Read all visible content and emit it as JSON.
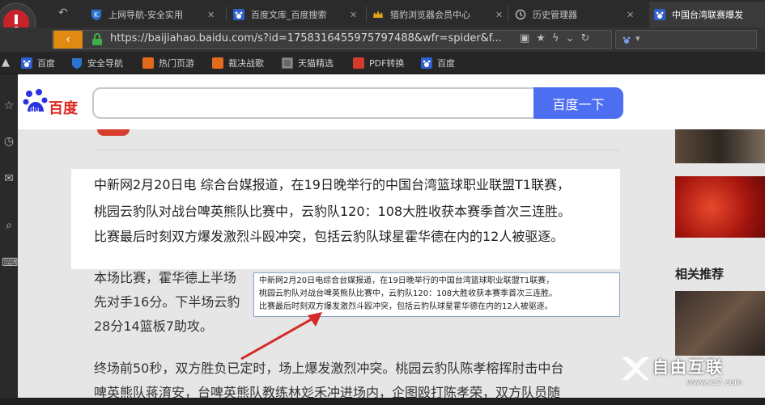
{
  "tabs": [
    {
      "label": "上网导航-安全实用",
      "icon": "shield-k-icon",
      "active": false
    },
    {
      "label": "百度文库_百度搜索",
      "icon": "baidu-paw-icon",
      "active": false
    },
    {
      "label": "猎豹浏览器会员中心",
      "icon": "crown-icon",
      "active": false
    },
    {
      "label": "历史管理器",
      "icon": "history-icon",
      "active": false
    },
    {
      "label": "中国台湾联赛爆发",
      "icon": "baidu-paw-icon",
      "active": true
    }
  ],
  "address": {
    "url": "https://baijiahao.baidu.com/s?id=1758316455975797488&wfr=spider&f..."
  },
  "bookmarks": [
    {
      "label": "百度",
      "icon": "baidu-paw-icon"
    },
    {
      "label": "安全导航",
      "icon": "shield-k-icon"
    },
    {
      "label": "热门页游",
      "icon": "game-k-icon"
    },
    {
      "label": "裁决战歌",
      "icon": "game-k-icon"
    },
    {
      "label": "天猫精选",
      "icon": "tmall-icon"
    },
    {
      "label": "PDF转换",
      "icon": "pdf-icon"
    },
    {
      "label": "百度",
      "icon": "baidu-paw-icon"
    }
  ],
  "baidu": {
    "logo_text": "百度",
    "search_button": "百度一下"
  },
  "article": {
    "highlight_lines": [
      "中新网2月20日电 综合台媒报道，在19日晚举行的中国台湾篮球职业联盟T1联赛，",
      "桃园云豹队对战台啤英熊队比赛中，云豹队120：108大胜收获本赛季首次三连胜。",
      "比赛最后时刻双方爆发激烈斗殴冲突，包括云豹队球星霍华德在内的12人被驱逐。"
    ],
    "para2_lines": [
      "本场比赛，霍华德上半场",
      "先对手16分。下半场云豹",
      "28分14篮板7助攻。"
    ],
    "para3_lines": [
      "终场前50秒，双方胜负已定时，场上爆发激烈冲突。桃园云豹队陈孝榕挥肘击中台",
      "啤英熊队蒋淯安，台啤英熊队教练林彣禾冲进场内，企图殴打陈孝荣，双方队员随"
    ]
  },
  "tooltip": {
    "lines": [
      "中新网2月20日电综合台媒报道，在19日晚举行的中国台湾篮球职业联盟T1联赛，",
      "桃园云豹队对战台啤英熊队比赛中，云豹队120：108大胜收获本赛季首次三连胜。",
      "比赛最后时刻双方爆发激烈斗殴冲突，包括云豹队球星霍华德在内的12人被驱逐。"
    ]
  },
  "right_panel": {
    "heading": "相关推荐"
  },
  "watermark": {
    "text": "自由互联",
    "subtext": "www.xz7.com"
  },
  "colors": {
    "baidu_blue": "#4e6ef2",
    "baidu_red": "#de2921",
    "chrome_dark": "#2b2b2b",
    "annotation_red": "#d42a2a"
  }
}
